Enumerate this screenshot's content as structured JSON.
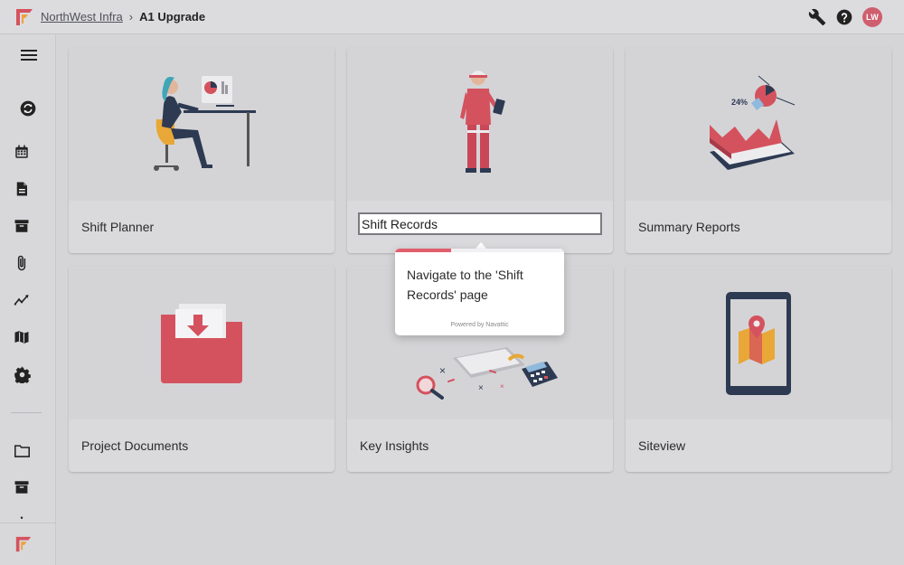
{
  "header": {
    "org_link": "NorthWest Infra",
    "separator": "›",
    "current": "A1 Upgrade",
    "icons": [
      "wrench-icon",
      "help-icon"
    ],
    "avatar_initials": "LW"
  },
  "sidebar": {
    "items": [
      "menu-icon",
      "sync-icon",
      "calendar-icon",
      "document-icon",
      "archive-icon",
      "attachment-icon",
      "analytics-icon",
      "map-icon",
      "settings-icon",
      "folder-icon",
      "archive-icon"
    ]
  },
  "cards": [
    {
      "label": "Shift Planner"
    },
    {
      "label": "Shift Records"
    },
    {
      "label": "Summary Reports"
    },
    {
      "label": "Project Documents"
    },
    {
      "label": "Key Insights"
    },
    {
      "label": "Siteview"
    }
  ],
  "tooltip": {
    "text": "Navigate to the 'Shift Records' page",
    "powered_by": "Powered by Navattic",
    "progress": 0.33
  },
  "colors": {
    "accent": "#e15e6c",
    "brand_red": "#d4525e",
    "brand_orange": "#f0a03c",
    "background": "#d5d5d8"
  }
}
